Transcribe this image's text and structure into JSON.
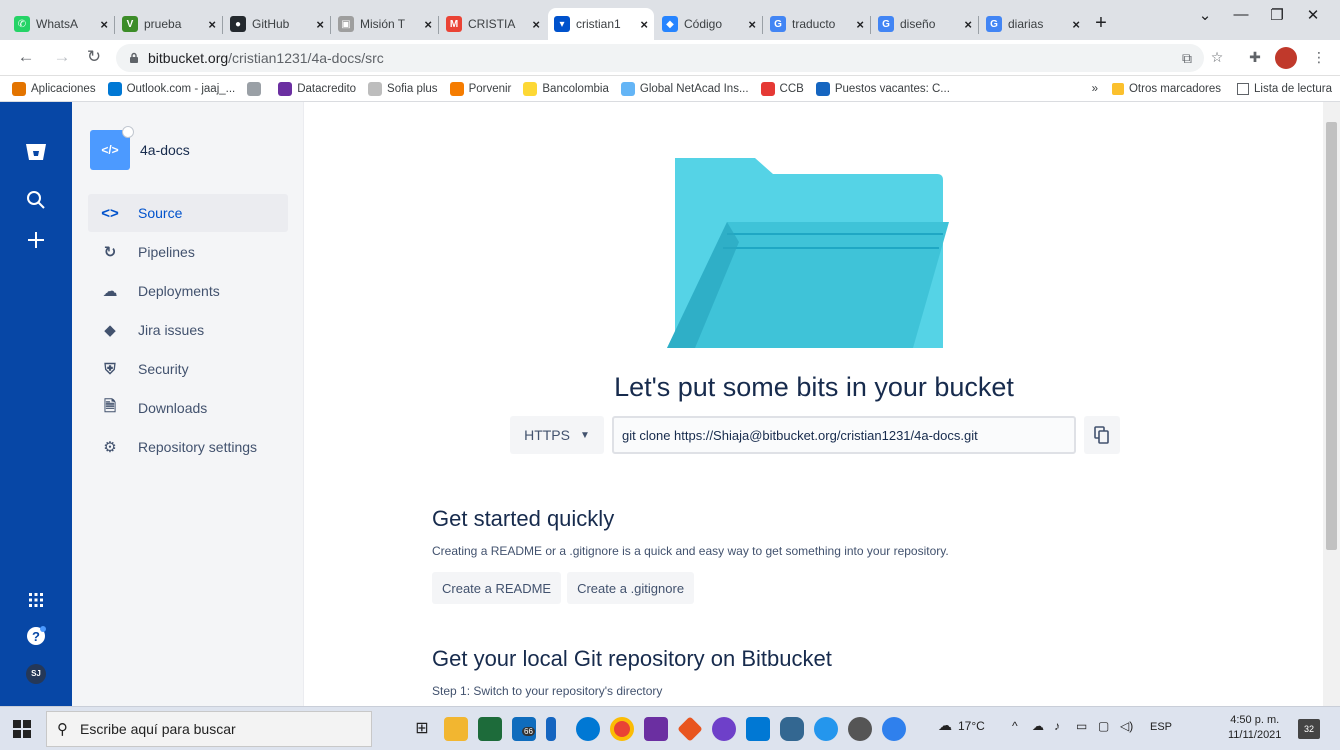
{
  "browser": {
    "tabs": [
      {
        "title": "WhatsA",
        "color": "#25d366",
        "glyph": "✆"
      },
      {
        "title": "prueba",
        "color": "#3c8c28",
        "glyph": "V"
      },
      {
        "title": "GitHub",
        "color": "#24292e",
        "glyph": "●"
      },
      {
        "title": "Misión T",
        "color": "#9e9e9e",
        "glyph": "▣"
      },
      {
        "title": "CRISTIA",
        "color": "#ea4335",
        "glyph": "M"
      },
      {
        "title": "cristian1",
        "color": "#0052cc",
        "glyph": "▾"
      },
      {
        "title": "Código",
        "color": "#2684ff",
        "glyph": "◆"
      },
      {
        "title": "traducto",
        "color": "#4285f4",
        "glyph": "G"
      },
      {
        "title": "diseño",
        "color": "#4285f4",
        "glyph": "G"
      },
      {
        "title": "diarias",
        "color": "#4285f4",
        "glyph": "G"
      }
    ],
    "url_host": "bitbucket.org",
    "url_path": "/cristian1231/4a-docs/src",
    "bookmarks": [
      {
        "label": "Aplicaciones",
        "color": "#e37400"
      },
      {
        "label": "Outlook.com - jaaj_...",
        "color": "#0078d4"
      },
      {
        "label": "",
        "color": "#9aa0a6"
      },
      {
        "label": "Datacredito",
        "color": "#6b2fa1"
      },
      {
        "label": "Sofia plus",
        "color": "#bdbdbd"
      },
      {
        "label": "Porvenir",
        "color": "#f57c00"
      },
      {
        "label": "Bancolombia",
        "color": "#fdd835"
      },
      {
        "label": "Global NetAcad Ins...",
        "color": "#64b5f6"
      },
      {
        "label": "CCB",
        "color": "#e53935"
      },
      {
        "label": "Puestos vacantes: C...",
        "color": "#1565c0"
      }
    ],
    "bookmarks_more": "»",
    "other_bookmarks": "Otros marcadores",
    "reading_list": "Lista de lectura"
  },
  "repo": {
    "name": "4a-docs",
    "icon_text": "</>",
    "nav": [
      {
        "label": "Source",
        "icon": "<>",
        "icon_name": "source-code-icon",
        "active": true
      },
      {
        "label": "Pipelines",
        "icon": "↻",
        "icon_name": "pipelines-icon",
        "active": false
      },
      {
        "label": "Deployments",
        "icon": "☁",
        "icon_name": "deployments-icon",
        "active": false
      },
      {
        "label": "Jira issues",
        "icon": "◆",
        "icon_name": "jira-icon",
        "active": false
      },
      {
        "label": "Security",
        "icon": "⛨",
        "icon_name": "shield-icon",
        "active": false
      },
      {
        "label": "Downloads",
        "icon": "🗎",
        "icon_name": "downloads-icon",
        "active": false
      },
      {
        "label": "Repository settings",
        "icon": "⚙",
        "icon_name": "gear-icon",
        "active": false
      }
    ]
  },
  "user": {
    "initials": "SJ"
  },
  "main": {
    "hero_title": "Let's put some bits in your bucket",
    "protocol": "HTTPS",
    "clone_command": "git clone https://Shiaja@bitbucket.org/cristian1231/4a-docs.git",
    "get_started": {
      "title": "Get started quickly",
      "text": "Creating a README or a .gitignore is a quick and easy way to get something into your repository.",
      "readme_label": "Create a README",
      "gitignore_label": "Create a .gitignore"
    },
    "local_repo": {
      "title": "Get your local Git repository on Bitbucket",
      "step1": "Step 1: Switch to your repository's directory"
    }
  },
  "taskbar": {
    "search_placeholder": "Escribe aquí para buscar",
    "mail_badge": "66",
    "weather": "17°C",
    "language": "ESP",
    "time": "4:50 p. m.",
    "date": "11/11/2021",
    "notifications": "32"
  },
  "colors": {
    "global_nav": "#0747a6",
    "accent": "#0052cc"
  }
}
